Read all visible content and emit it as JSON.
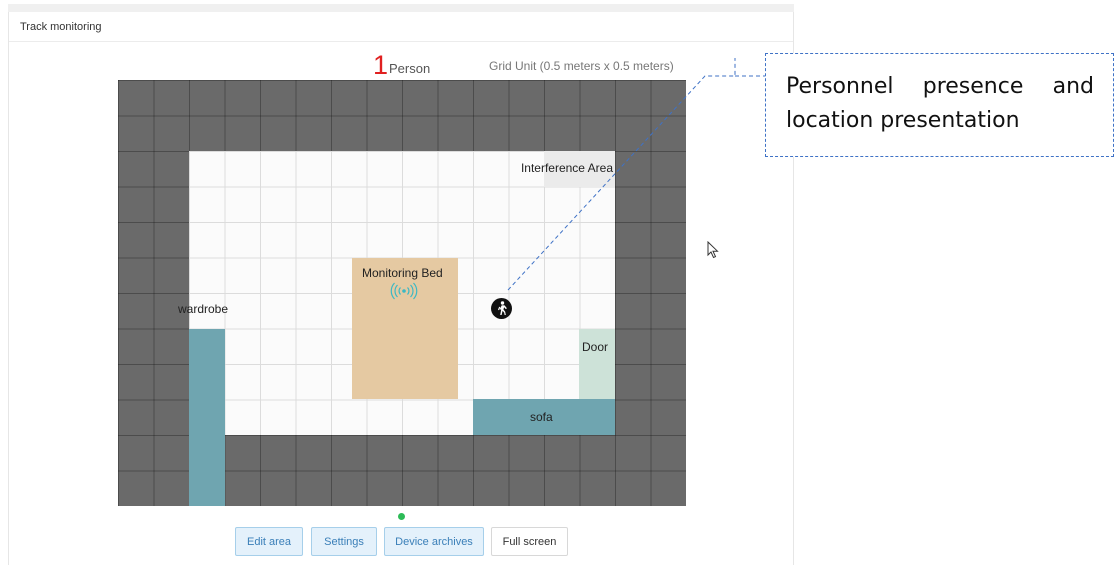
{
  "panel": {
    "title": "Track monitoring"
  },
  "stats": {
    "person_count": "1",
    "person_label": "Person",
    "grid_unit": "Grid Unit (0.5 meters x 0.5 meters)"
  },
  "zones": {
    "interference": "Interference Area",
    "bed": "Monitoring Bed",
    "wardrobe": "wardrobe",
    "door": "Door",
    "sofa": "sofa"
  },
  "icons": {
    "bed_signal": "wireless-signal-icon",
    "person": "walking-person-icon",
    "cursor": "mouse-cursor-icon",
    "status": "online-status-dot"
  },
  "buttons": {
    "edit_area": "Edit area",
    "settings": "Settings",
    "device_archives": "Device archives",
    "full_screen": "Full screen"
  },
  "callout": {
    "text": "Personnel presence and location presentation"
  },
  "colors": {
    "outside_area": "#6a6a6a",
    "room_floor": "#fbfbfb",
    "bed": "#e5c9a2",
    "furniture": "#6fa5b0",
    "door": "#cde2d8",
    "interference": "#ebebeb",
    "count_red": "#e02020",
    "button_blue": "#3a7fb8",
    "status_green": "#2dbb57",
    "callout_border": "#3f72c6"
  }
}
